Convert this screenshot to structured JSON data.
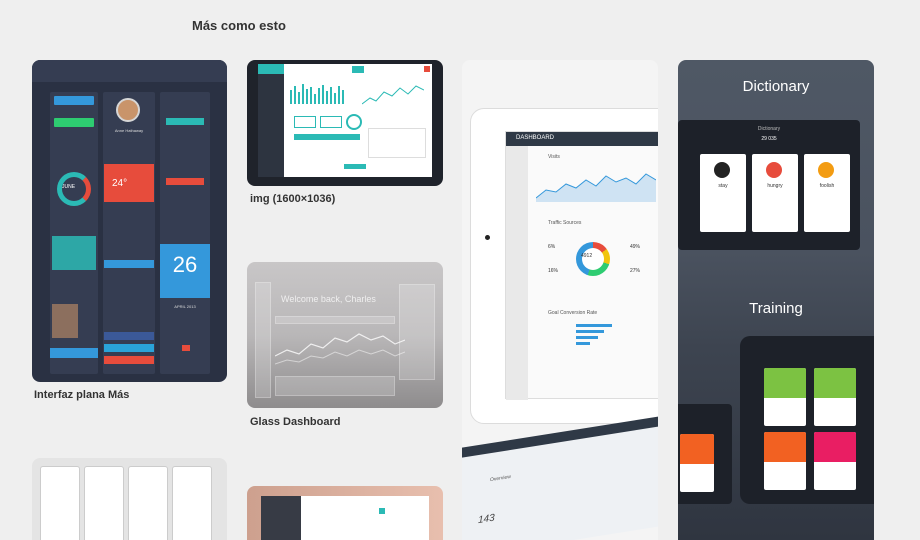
{
  "section": {
    "title": "Más como esto"
  },
  "pins": [
    {
      "caption": "Interfaz plana Más"
    },
    {
      "caption": "img (1600×1036)"
    },
    {
      "caption": "Glass Dashboard"
    }
  ],
  "pin1": {
    "profile_name": "Anne Hathaway",
    "date_month": "JUNE",
    "temperature": "24°",
    "calendar_day": "26",
    "calendar_month": "APRIL 2013"
  },
  "pin3": {
    "welcome": "Welcome back, Charles"
  },
  "pin4": {
    "header": "DASHBOARD",
    "visits": "Visits",
    "traffic": "Traffic Sources",
    "donut_number": "4912",
    "pct_1": "6%",
    "pct_2": "49%",
    "pct_3": "16%",
    "pct_4": "27%",
    "goal": "Goal Conversion Rate",
    "lower_label": "Overview",
    "lower_number": "143"
  },
  "pin5": {
    "dictionary": "Dictionary",
    "training": "Training",
    "words": [
      "stay",
      "hungry",
      "foolish"
    ],
    "dict_header": "Dictionary",
    "dict_count": "29 035"
  },
  "colors": {
    "bg": "#efefef",
    "teal": "#2bbab5",
    "red": "#e74c3c",
    "blue": "#3498db",
    "green": "#7cc242"
  }
}
